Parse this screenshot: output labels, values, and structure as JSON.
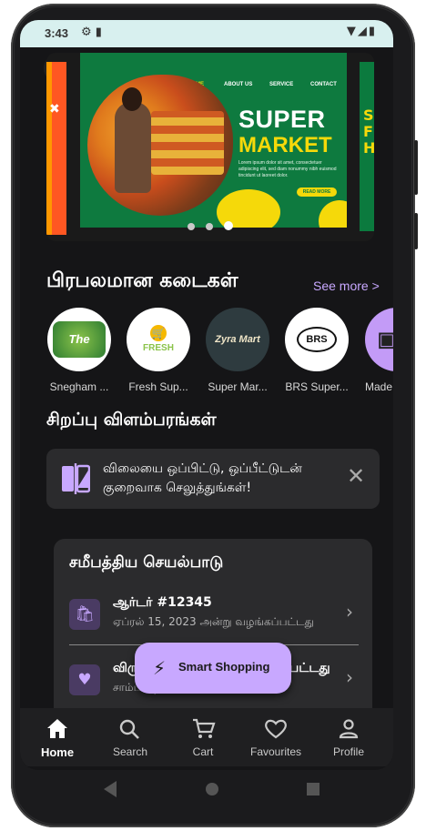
{
  "status_bar": {
    "time": "3:43",
    "left_icons": [
      "gear-icon",
      "sim-card-icon"
    ],
    "right_icons": [
      "wifi-icon",
      "signal-icon",
      "battery-icon"
    ]
  },
  "banner": {
    "nav": [
      "HOME",
      "ABOUT US",
      "SERVICE",
      "CONTACT"
    ],
    "title_line1": "SUPER",
    "title_line2": "MARKET",
    "body": "Lorem ipsum dolor sit amet, consectetuer adipiscing elit, sed diam nonummy nibh euismod tincidunt ut laoreet dolor.",
    "cta": "READ MORE",
    "slides_count": 3,
    "active_slide": 3,
    "colors": {
      "green": "#0e7a3f",
      "yellow": "#f5d90a",
      "orange": "#ff5722"
    }
  },
  "popular_stores": {
    "title": "பிரபலமான கடைகள்",
    "see_more": "See more >",
    "items": [
      {
        "name": "Snegham ...",
        "logo_text": "The Green"
      },
      {
        "name": "Fresh Sup...",
        "logo_text": "FRESH"
      },
      {
        "name": "Super Mar...",
        "logo_text": "Zyra Mart"
      },
      {
        "name": "BRS Super...",
        "logo_text": "BRS"
      },
      {
        "name": "Made",
        "logo_text": ""
      }
    ]
  },
  "special_offers": {
    "title": "சிறப்பு விளம்பரங்கள்",
    "promo_text": "விலையை ஒப்பிட்டு, ஒப்பீட்டுடன் குறைவாக செலுத்துங்கள்!"
  },
  "recent_activity": {
    "title": "சமீபத்திய செயல்பாடு",
    "items": [
      {
        "title": "ஆர்டர் #12345",
        "subtitle": "ஏப்ரல் 15, 2023 அன்று வழங்கப்பட்டது",
        "icon": "shopping-bag-icon"
      },
      {
        "title": "விருப்பப் பட்டியலில் சேர்க்கப்பட்டது",
        "subtitle": "சாம்பல் நிற பேன்ட்",
        "icon": "heart-icon"
      }
    ]
  },
  "fab": {
    "label": "Smart Shopping",
    "icon": "bolt-icon"
  },
  "bottom_nav": {
    "items": [
      {
        "label": "Home",
        "icon": "home-icon",
        "active": true
      },
      {
        "label": "Search",
        "icon": "search-icon",
        "active": false
      },
      {
        "label": "Cart",
        "icon": "cart-icon",
        "active": false
      },
      {
        "label": "Favourites",
        "icon": "heart-icon",
        "active": false
      },
      {
        "label": "Profile",
        "icon": "person-icon",
        "active": false
      }
    ]
  }
}
